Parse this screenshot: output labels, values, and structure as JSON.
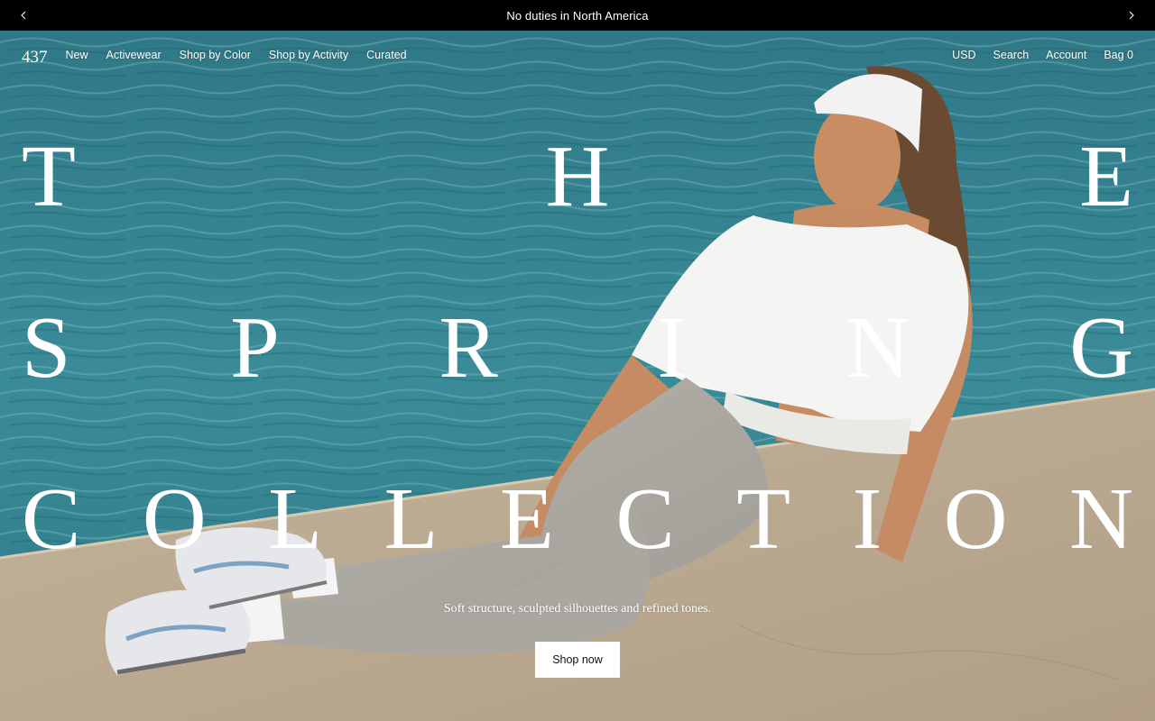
{
  "announcement": {
    "text": "No duties in North America",
    "prev_icon": "chevron-left-icon",
    "next_icon": "chevron-right-icon"
  },
  "header": {
    "logo": "437",
    "nav_left": [
      "New",
      "Activewear",
      "Shop by Color",
      "Shop by Activity",
      "Curated"
    ],
    "nav_right": [
      "USD",
      "Search",
      "Account",
      "Bag 0"
    ]
  },
  "hero": {
    "headline_lines": [
      [
        "T",
        "H",
        "E"
      ],
      [
        "S",
        "P",
        "R",
        "I",
        "N",
        "G"
      ],
      [
        "C",
        "O",
        "L",
        "L",
        "E",
        "C",
        "T",
        "I",
        "O",
        "N"
      ]
    ],
    "tagline": "Soft structure, sculpted silhouettes and refined tones.",
    "cta_label": "Shop now",
    "image_subject": "model-seated-on-concrete-by-water"
  },
  "colors": {
    "announcement_bg": "#000000",
    "water": "#3b8795",
    "concrete": "#b9a891",
    "cta_bg": "#ffffff",
    "text": "#ffffff"
  }
}
